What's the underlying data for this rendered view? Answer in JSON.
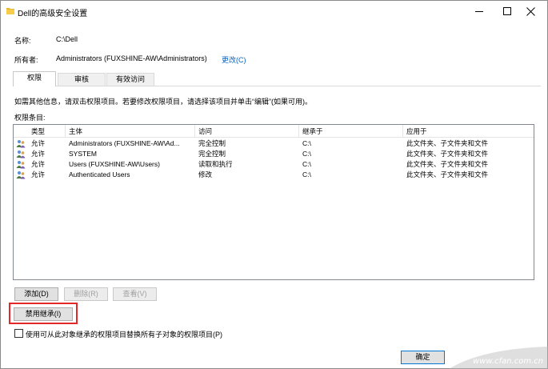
{
  "window": {
    "title": "Dell的高级安全设置"
  },
  "info": {
    "name_label": "名称:",
    "name_value": "C:\\Dell",
    "owner_label": "所有者:",
    "owner_value": "Administrators (FUXSHINE-AW\\Administrators)",
    "change_link": "更改(C)"
  },
  "tabs": [
    {
      "label": "权限"
    },
    {
      "label": "审核"
    },
    {
      "label": "有效访问"
    }
  ],
  "instructions": "如需其他信息，请双击权限项目。若要修改权限项目，请选择该项目并单击“编辑”(如果可用)。",
  "entries_label": "权限条目:",
  "table": {
    "columns": [
      "类型",
      "主体",
      "访问",
      "继承于",
      "应用于"
    ],
    "rows": [
      {
        "type": "允许",
        "principal": "Administrators (FUXSHINE-AW\\Ad...",
        "access": "完全控制",
        "inherited": "C:\\",
        "applies": "此文件夹、子文件夹和文件"
      },
      {
        "type": "允许",
        "principal": "SYSTEM",
        "access": "完全控制",
        "inherited": "C:\\",
        "applies": "此文件夹、子文件夹和文件"
      },
      {
        "type": "允许",
        "principal": "Users (FUXSHINE-AW\\Users)",
        "access": "读取和执行",
        "inherited": "C:\\",
        "applies": "此文件夹、子文件夹和文件"
      },
      {
        "type": "允许",
        "principal": "Authenticated Users",
        "access": "修改",
        "inherited": "C:\\",
        "applies": "此文件夹、子文件夹和文件"
      }
    ]
  },
  "buttons": {
    "add": "添加(D)",
    "remove": "删除(R)",
    "view": "查看(V)",
    "disable_inheritance": "禁用继承(I)",
    "ok": "确定"
  },
  "replace_checkbox_label": "使用可从此对象继承的权限项目替换所有子对象的权限项目(P)",
  "watermark_text": "www.cfan.com.cn",
  "colors": {
    "link": "#0066cc",
    "highlight": "#e3282a",
    "default_button_border": "#0078d7"
  }
}
